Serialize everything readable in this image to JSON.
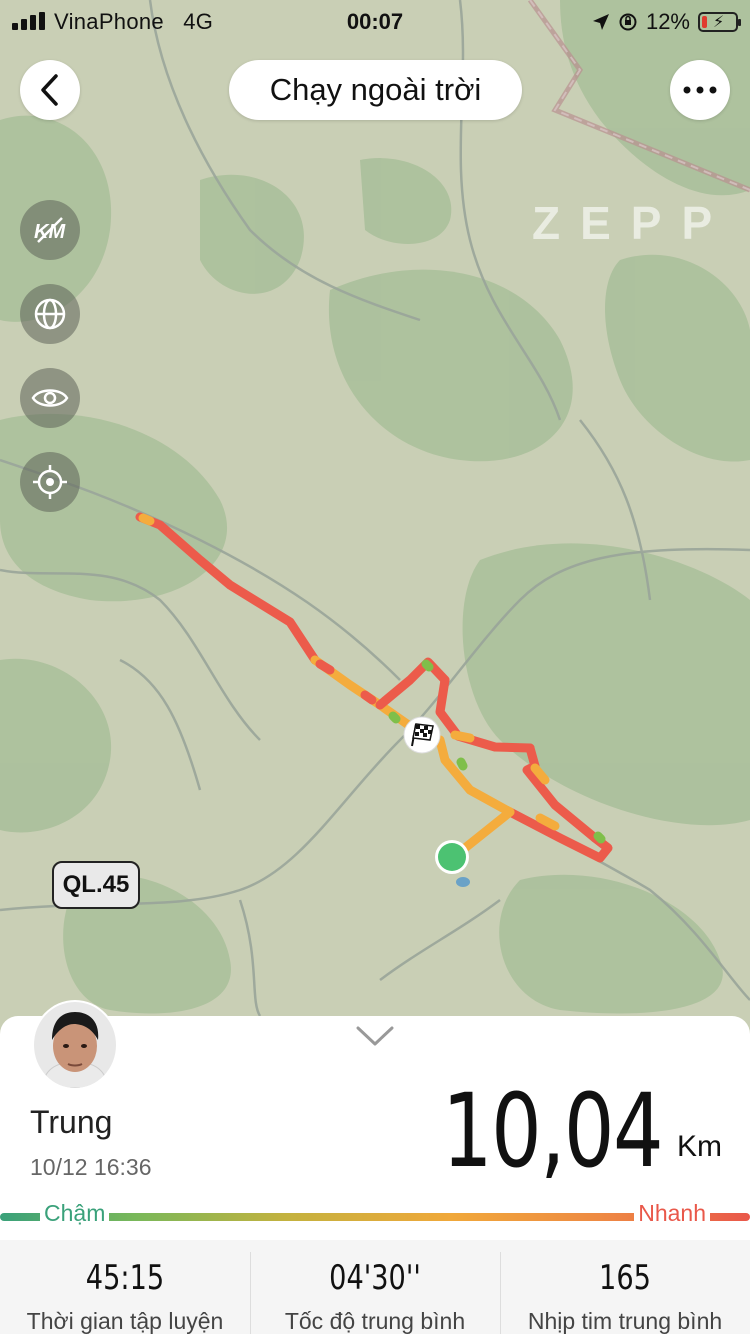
{
  "status_bar": {
    "carrier": "VinaPhone",
    "network": "4G",
    "time": "00:07",
    "battery": "12%"
  },
  "header": {
    "title": "Chạy ngoài trời",
    "back_icon": "back-icon",
    "more_icon": "more-icon"
  },
  "map": {
    "watermark": "ZEPP",
    "road_badge": "QL.45",
    "tools": [
      "km-marker-icon",
      "globe-icon",
      "eye-icon",
      "locate-icon"
    ],
    "colors": {
      "fast": "#e9584a",
      "medium": "#f4ac3d",
      "slow": "#7fbf4a",
      "start": "#4cc272"
    }
  },
  "summary": {
    "name": "Trung",
    "datetime": "10/12 16:36",
    "distance": "10,04",
    "distance_unit": "Km",
    "legend_slow": "Chậm",
    "legend_fast": "Nhanh",
    "stats": [
      {
        "value": "45:15",
        "label": "Thời gian tập luyện"
      },
      {
        "value": "04'30''",
        "label": "Tốc độ trung bình"
      },
      {
        "value": "165",
        "label": "Nhịp tim trung bình"
      }
    ]
  }
}
